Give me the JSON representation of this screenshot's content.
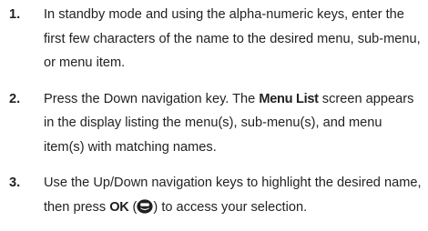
{
  "steps": [
    {
      "number": "1.",
      "text": "In standby mode and using the alpha-numeric keys, enter the first few characters of the name to the desired menu, sub-menu, or menu item."
    },
    {
      "number": "2.",
      "text_before": "Press the Down navigation key. The ",
      "bold": "Menu List",
      "text_after": " screen appears in the display listing the menu(s), sub-menu(s), and menu item(s) with matching names."
    },
    {
      "number": "3.",
      "text_before": "Use the Up/Down navigation keys to highlight the desired name, then press ",
      "bold": "OK",
      "paren_open": " (",
      "icon": "ok-key-icon",
      "text_after": ") to access your selection."
    }
  ]
}
